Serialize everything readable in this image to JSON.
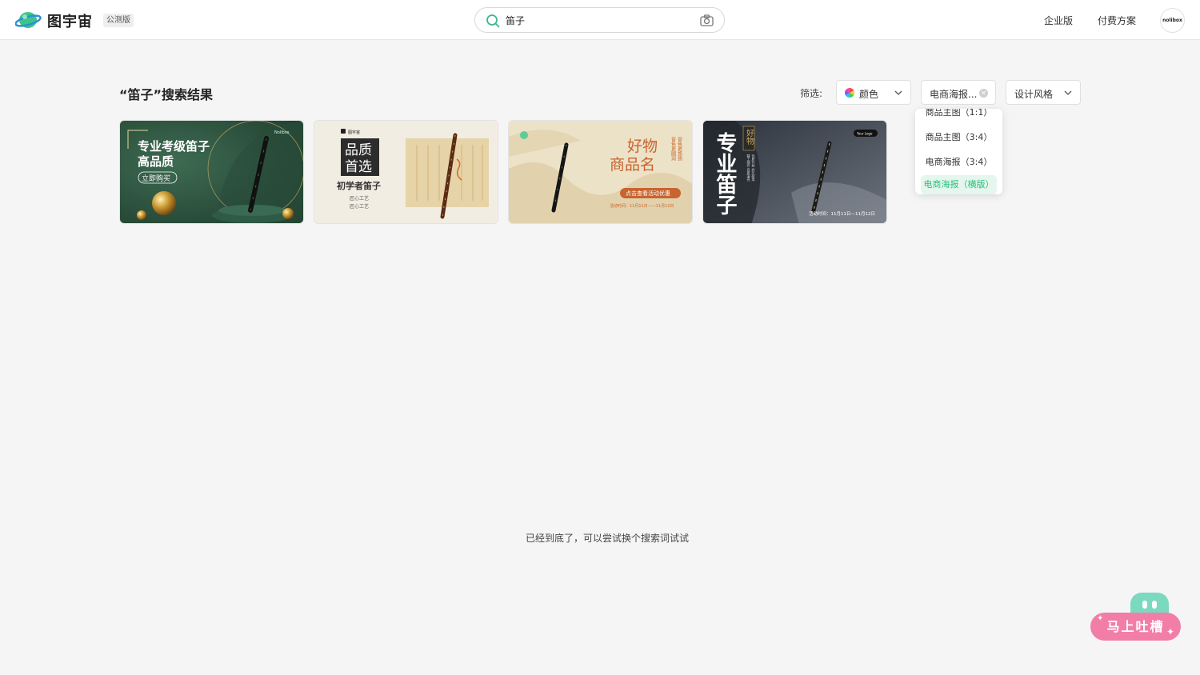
{
  "header": {
    "logo_text": "图宇宙",
    "beta_badge": "公测版",
    "search_value": "笛子",
    "nav": [
      "企业版",
      "付费方案"
    ],
    "avatar_text": "nolibox"
  },
  "results": {
    "title": "“笛子”搜索结果",
    "filter_label": "筛选:",
    "filters": {
      "color": "颜色",
      "size": "电商海报...",
      "style": "设计风格"
    },
    "dropdown": [
      "商品主图（1:1）",
      "商品主图（3:4）",
      "电商海报（3:4）",
      "电商海报（横版）"
    ],
    "dropdown_selected": "电商海报（横版）"
  },
  "cards": [
    {
      "title": "专业考级笛子",
      "subtitle": "高品质",
      "tag": "立即购买",
      "logo": "Nolibox"
    },
    {
      "title_top": "品质",
      "title_bottom": "首选",
      "subtitle": "初学者笛子",
      "line1": "匠心工艺",
      "line2": "匠心工艺",
      "logo": "图宇宙"
    },
    {
      "title_top": "好物",
      "title_bottom": "商品名",
      "side_text": "音色更圆润",
      "side_text2": "音色更悠扬",
      "cta": "点击查看活动优惠",
      "time": "活动时间：11月11日——11月12日"
    },
    {
      "title": "专业笛子",
      "badge": "好物",
      "side1": "精工细作 音质清亮",
      "side2": "优质竹材 经久耐用",
      "logo": "Your Logo",
      "time": "活动时间：11月11日—11月12日"
    }
  ],
  "end_text": "已经到底了，可以尝试换个搜索词试试",
  "feedback_label": "马上吐槽",
  "colors": {
    "accent": "#2bc07a",
    "feedback": "#f27ea7"
  }
}
